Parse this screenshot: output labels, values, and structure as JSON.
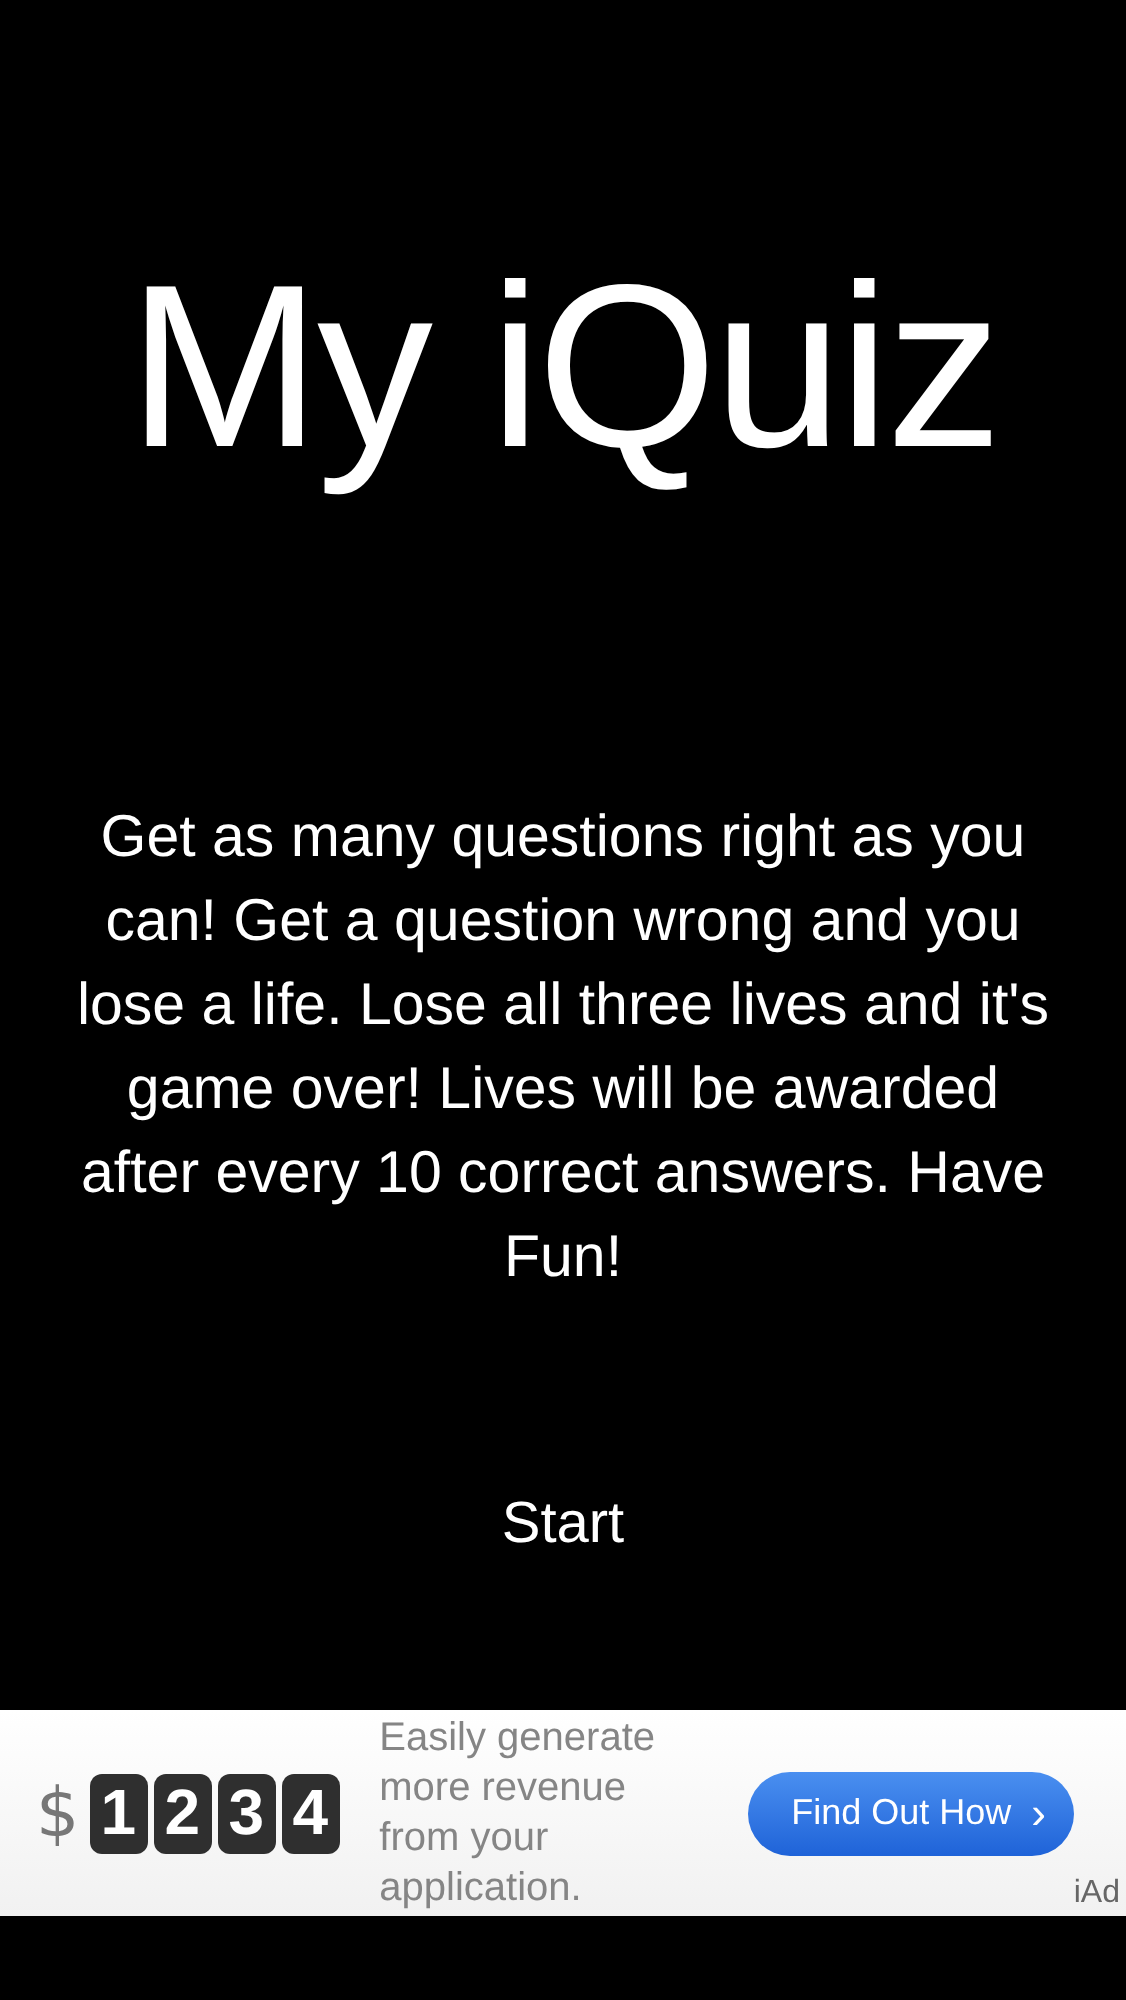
{
  "title": "My iQuiz",
  "instructions": "Get as many questions right as you can! Get a question wrong and you lose a life. Lose all three lives and it's game over! Lives will be awarded after every 10 correct answers. Have Fun!",
  "start_button": "Start",
  "ad_banner": {
    "currency": "$",
    "digits": [
      "1",
      "2",
      "3",
      "4"
    ],
    "text": "Easily generate more revenue from your application.",
    "button": "Find Out How",
    "caret": "›",
    "brand": "iAd"
  }
}
